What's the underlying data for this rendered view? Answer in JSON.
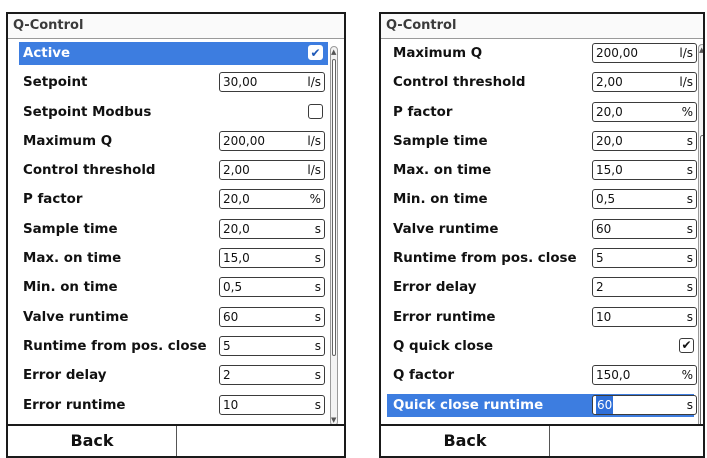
{
  "left": {
    "title": "Q-Control",
    "rows": [
      {
        "label": "Active",
        "type": "check",
        "checked": true,
        "selected": true
      },
      {
        "label": "Setpoint",
        "type": "field",
        "value": "30,00",
        "unit": "l/s"
      },
      {
        "label": "Setpoint Modbus",
        "type": "check",
        "checked": false
      },
      {
        "label": "Maximum Q",
        "type": "field",
        "value": "200,00",
        "unit": "l/s"
      },
      {
        "label": "Control threshold",
        "type": "field",
        "value": "2,00",
        "unit": "l/s"
      },
      {
        "label": "P factor",
        "type": "field",
        "value": "20,0",
        "unit": "%"
      },
      {
        "label": "Sample time",
        "type": "field",
        "value": "20,0",
        "unit": "s"
      },
      {
        "label": "Max. on time",
        "type": "field",
        "value": "15,0",
        "unit": "s"
      },
      {
        "label": "Min. on time",
        "type": "field",
        "value": "0,5",
        "unit": "s"
      },
      {
        "label": "Valve runtime",
        "type": "field",
        "value": "60",
        "unit": "s"
      },
      {
        "label": "Runtime from pos. close",
        "type": "field",
        "value": "5",
        "unit": "s"
      },
      {
        "label": "Error delay",
        "type": "field",
        "value": "2",
        "unit": "s"
      },
      {
        "label": "Error runtime",
        "type": "field",
        "value": "10",
        "unit": "s"
      }
    ],
    "buttons": [
      "Back",
      ""
    ]
  },
  "right": {
    "title": "Q-Control",
    "rows": [
      {
        "label": "Maximum Q",
        "type": "field",
        "value": "200,00",
        "unit": "l/s"
      },
      {
        "label": "Control threshold",
        "type": "field",
        "value": "2,00",
        "unit": "l/s"
      },
      {
        "label": "P factor",
        "type": "field",
        "value": "20,0",
        "unit": "%"
      },
      {
        "label": "Sample time",
        "type": "field",
        "value": "20,0",
        "unit": "s"
      },
      {
        "label": "Max. on time",
        "type": "field",
        "value": "15,0",
        "unit": "s"
      },
      {
        "label": "Min. on time",
        "type": "field",
        "value": "0,5",
        "unit": "s"
      },
      {
        "label": "Valve runtime",
        "type": "field",
        "value": "60",
        "unit": "s"
      },
      {
        "label": "Runtime from pos. close",
        "type": "field",
        "value": "5",
        "unit": "s"
      },
      {
        "label": "Error delay",
        "type": "field",
        "value": "2",
        "unit": "s"
      },
      {
        "label": "Error runtime",
        "type": "field",
        "value": "10",
        "unit": "s"
      },
      {
        "label": "Q quick close",
        "type": "check",
        "checked": true
      },
      {
        "label": "Q factor",
        "type": "field",
        "value": "150,0",
        "unit": "%"
      },
      {
        "label": "Quick close runtime",
        "type": "field",
        "value": "60",
        "unit": "s",
        "selected": true,
        "editing": true
      }
    ],
    "buttons": [
      "Back",
      ""
    ]
  },
  "colors": {
    "accent": "#3d7de0",
    "border": "#1a1a1a"
  },
  "icons": {
    "check": "check-icon",
    "scroll_up": "scroll-up-arrow-icon",
    "scroll_down": "scroll-down-arrow-icon"
  }
}
